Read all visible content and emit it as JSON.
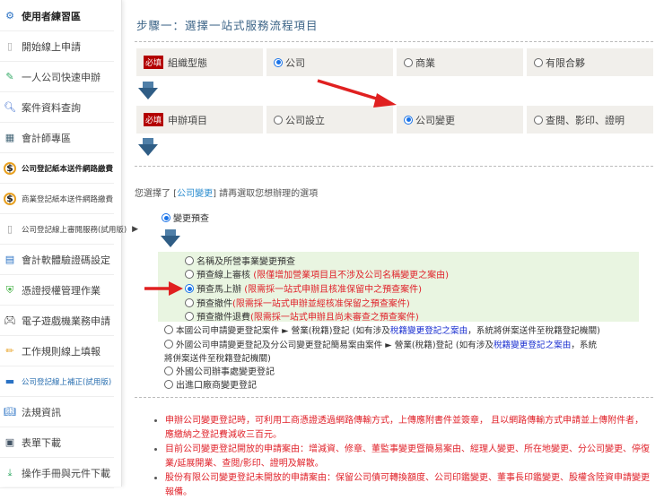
{
  "sidebar": {
    "items": [
      {
        "label": "使用者練習區",
        "icon": "gears-icon"
      },
      {
        "label": "開始線上申請",
        "icon": "document-icon"
      },
      {
        "label": "一人公司快速申辦",
        "icon": "clipboard-edit-icon"
      },
      {
        "label": "案件資料查詢",
        "icon": "search-icon"
      },
      {
        "label": "會計師專區",
        "icon": "calculator-icon"
      },
      {
        "label": "公司登記紙本送件網路繳費",
        "icon": "dollar-icon"
      },
      {
        "label": "商業登記紙本送件網路繳費",
        "icon": "dollar-icon"
      },
      {
        "label": "公司登記線上審閱服務(試用版)",
        "icon": "phone-icon"
      },
      {
        "label": "會計軟體驗證碼設定",
        "icon": "calculator-grid-icon"
      },
      {
        "label": "憑證授權管理作業",
        "icon": "shield-check-icon"
      },
      {
        "label": "電子遊戲機業務申請",
        "icon": "gamepad-icon"
      },
      {
        "label": "工作規則線上填報",
        "icon": "pencil-icon"
      },
      {
        "label": "公司登記線上補正(試用版)",
        "icon": "card-icon"
      },
      {
        "label": "法規資訊",
        "icon": "book-icon"
      },
      {
        "label": "表單下載",
        "icon": "save-icon"
      },
      {
        "label": "操作手冊與元件下載",
        "icon": "download-icon"
      }
    ]
  },
  "main": {
    "title": "步驟一：選擇一站式服務流程項目",
    "required_tag": "必填",
    "row1": {
      "label": "組織型態",
      "options": [
        "公司",
        "商業",
        "有限合夥"
      ],
      "selected": 0
    },
    "row2": {
      "label": "申辦項目",
      "options": [
        "公司設立",
        "公司變更",
        "查閱、影印、證明"
      ],
      "selected": 1
    },
    "chosen": {
      "prefix": "您選擇了 [",
      "link": "公司變更",
      "suffix": "] 請再選取您想辦理的選項"
    },
    "change_precheck": "變更預查",
    "sub_options": [
      {
        "label": "名稱及所營事業變更預查",
        "note": ""
      },
      {
        "label": "預查線上審核 ",
        "note": "(限僅增加營業項目且不涉及公司名稱變更之案由)"
      },
      {
        "label": "預查馬上辦 ",
        "note": "(限需採一站式申辦且核准保留中之預查案件)"
      },
      {
        "label": "預查撤件",
        "note": "(限需採一站式申辦並經核准保留之預查案件)"
      },
      {
        "label": "預查撤件退費",
        "note": "(限需採一站式申辦且尚未審查之預查案件)"
      }
    ],
    "other_options": [
      {
        "a": "本國公司申請變更登記案件 ► 營業(稅籍)登記 (如有涉及",
        "link": "稅籍變更登記之案由",
        "b": "，系統將併案送件至稅籍登記機關)"
      },
      {
        "a": "外國公司申請變更登記及分公司變更登記簡易案由案件 ► 營業(稅籍)登記 (如有涉及",
        "link": "稅籍變更登記之案由",
        "b": "，系統",
        "c": "將併案送件至稅籍登記機關)"
      },
      {
        "a": "外國公司辦事處變更登記"
      },
      {
        "a": "出進口廠商變更登記"
      }
    ],
    "notes": [
      "申辦公司變更登記時，可利用工商憑證透過網路傳輸方式，上傳應附書件並簽章， 且以網路傳輸方式申請並上傳附件者，應繳納之登記費減收三百元。",
      "目前公司變更登記開放的申請案由：增減資、修章、董監事變更暨簡易案由、經理人變更、所在地變更、分公司變更、停復業/延展開業、查閱/影印、證明及解散。",
      "股份有限公司變更登記未開放的申請案由：保留公司債可轉換額度、公司印鑑變更、董事長印鑑變更、股權含陸資申請變更報備。"
    ],
    "colors": {
      "accent": "#2f5d85",
      "required": "#b30000",
      "note": "#e0222a",
      "link": "#1a2fd0",
      "highlight": "#e9f5e1"
    }
  }
}
